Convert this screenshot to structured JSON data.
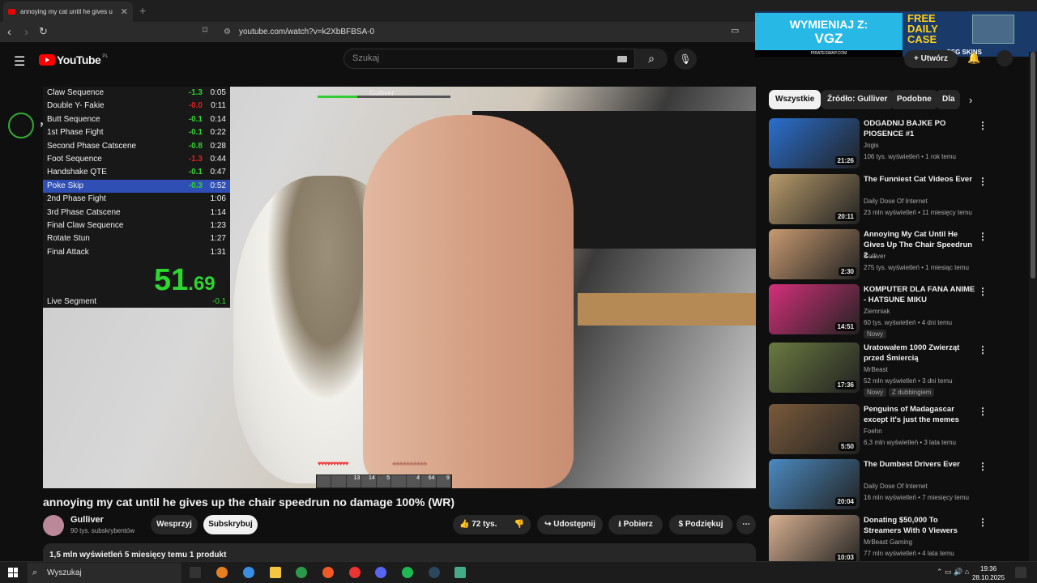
{
  "browser": {
    "tab_title": "annoying my cat until he gives u",
    "url": "youtube.com/watch?v=k2XbBFBSA-0"
  },
  "ad": {
    "left_title": "WYMIENIAJ Z:",
    "left_brand": "VGZ",
    "left_sub": "PIRATESWAP.COM",
    "right_title": "FREE DAILY CASE",
    "right_brand": "CSG SKINS"
  },
  "header": {
    "logo": "YouTube",
    "region": "PL",
    "search_placeholder": "Szukaj",
    "create_label": "Utwórz"
  },
  "splits": {
    "rows": [
      {
        "name": "Claw Sequence",
        "delta": "-1.3",
        "time": "0:05",
        "red": false
      },
      {
        "name": "Double Y- Fakie",
        "delta": "-0.0",
        "time": "0:11",
        "red": true
      },
      {
        "name": "Butt Sequence",
        "delta": "-0.1",
        "time": "0:14",
        "red": false
      },
      {
        "name": "1st Phase Fight",
        "delta": "-0.1",
        "time": "0:22",
        "red": false
      },
      {
        "name": "Second Phase Catscene",
        "delta": "-0.8",
        "time": "0:28",
        "red": false
      },
      {
        "name": "Foot Sequence",
        "delta": "-1.3",
        "time": "0:44",
        "red": true
      },
      {
        "name": "Handshake QTE",
        "delta": "-0.1",
        "time": "0:47",
        "red": false
      },
      {
        "name": "Poke Skip",
        "delta": "-0.3",
        "time": "0:52",
        "red": false
      },
      {
        "name": "2nd Phase Fight",
        "delta": "",
        "time": "1:06",
        "red": false
      },
      {
        "name": "3rd Phase Catscene",
        "delta": "",
        "time": "1:14",
        "red": false
      },
      {
        "name": "Final Claw Sequence",
        "delta": "",
        "time": "1:23",
        "red": false
      },
      {
        "name": "Rotate Stun",
        "delta": "",
        "time": "1:27",
        "red": false
      },
      {
        "name": "Final Attack",
        "delta": "",
        "time": "1:31",
        "red": false
      }
    ],
    "active_index": 7,
    "timer_main": "51",
    "timer_frac": ".69",
    "live_label": "Live Segment",
    "live_value": "-0.1"
  },
  "game_hud": {
    "player": "Gulliver",
    "hotbar": [
      "",
      "",
      "13",
      "14",
      "5",
      "",
      "4",
      "64",
      "9"
    ]
  },
  "video": {
    "title": "annoying my cat until he gives up the chair speedrun no damage 100% (WR)",
    "channel": "Gulliver",
    "subscribers": "90 tys. subskrybentów",
    "support_label": "Wesprzyj",
    "subscribe_label": "Subskrybuj",
    "likes": "72 tys.",
    "share_label": "Udostępnij",
    "download_label": "Pobierz",
    "thanks_label": "Podziękuj",
    "meta": "1,5 mln wyświetleń  5 miesięcy temu  1 produkt"
  },
  "chips": [
    "Wszystkie",
    "Źródło: Gulliver",
    "Podobne",
    "Dla"
  ],
  "recommendations": [
    {
      "title": "ODGADNIJ BAJKE PO PIOSENCE #1",
      "channel": "Jogis",
      "meta": "106 tys. wyświetleń • 1 rok temu",
      "duration": "21:26",
      "badge": "",
      "color": "#2a6fcf"
    },
    {
      "title": "The Funniest Cat Videos Ever",
      "channel": "Daily Dose Of Internet",
      "meta": "23 mln wyświetleń • 11 miesięcy temu",
      "duration": "20:11",
      "badge": "",
      "color": "#b79a6a"
    },
    {
      "title": "Annoying My Cat Until He Gives Up The Chair Speedrun 2 ...",
      "channel": "Gulliver",
      "meta": "275 tys. wyświetleń • 1 miesiąc temu",
      "duration": "2:30",
      "badge": "",
      "color": "#c89a70"
    },
    {
      "title": "KOMPUTER DLA FANA ANIME - HATSUNE MIKU",
      "channel": "Ziemniak",
      "meta": "60 tys. wyświetleń • 4 dni temu",
      "duration": "14:51",
      "badge": "Nowy",
      "color": "#d4307a"
    },
    {
      "title": "Uratowałem 1000 Zwierząt przed Śmiercią",
      "channel": "MrBeast",
      "meta": "52 mln wyświetleń • 3 dni temu",
      "duration": "17:36",
      "badge": "Nowy",
      "badge2": "Z dubbingiem",
      "color": "#6a7a40"
    },
    {
      "title": "Penguins of Madagascar except it's just the memes",
      "channel": "Foehn",
      "meta": "6,3 mln wyświetleń • 3 lata temu",
      "duration": "5:50",
      "badge": "",
      "color": "#7a5a3a"
    },
    {
      "title": "The Dumbest Drivers Ever",
      "channel": "Daily Dose Of Internet",
      "meta": "16 mln wyświetleń • 7 miesięcy temu",
      "duration": "20:04",
      "badge": "",
      "color": "#4a8ac0"
    },
    {
      "title": "Donating $50,000 To Streamers With 0 Viewers",
      "channel": "MrBeast Gaming",
      "meta": "77 mln wyświetleń • 4 lata temu",
      "duration": "10:03",
      "badge": "",
      "color": "#d8b090"
    }
  ],
  "taskbar": {
    "search": "Wyszukaj",
    "time": "19:36",
    "date": "28.10.2025"
  }
}
